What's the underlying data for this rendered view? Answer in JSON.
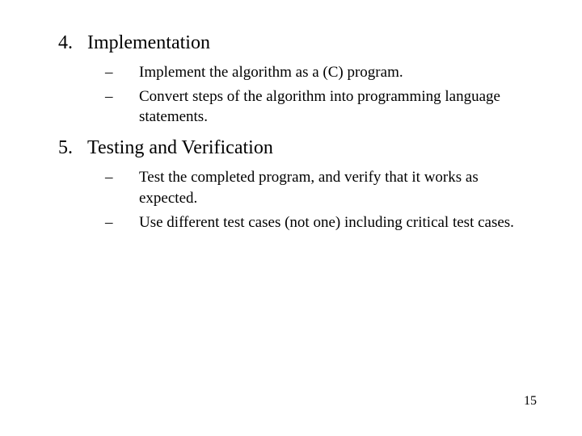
{
  "items": [
    {
      "number": "4.",
      "title": "Implementation",
      "subs": [
        "Implement the algorithm as a (C) program.",
        "Convert steps of the algorithm into programming language statements."
      ]
    },
    {
      "number": "5.",
      "title": "Testing and Verification",
      "subs": [
        "Test the completed program, and verify that it works as expected.",
        "Use different test cases (not one) including critical test cases."
      ]
    }
  ],
  "dash": "–",
  "page_number": "15"
}
